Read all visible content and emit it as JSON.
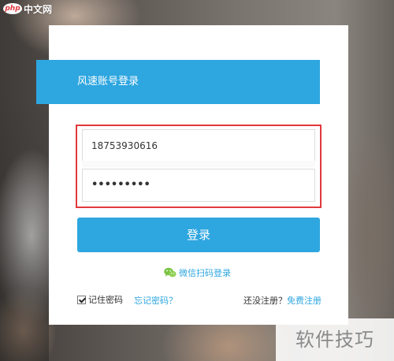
{
  "site_logo": {
    "php": "php",
    "text": "中文网"
  },
  "login": {
    "header_title": "风速账号登录",
    "phone_value": "18753930616",
    "password_mask": "•••••••••",
    "submit_label": "登录",
    "wechat_label": "微信扫码登录",
    "remember_label": "记住密码",
    "forgot_label": "忘记密码？",
    "no_account_label": "还没注册？",
    "register_link": "免费注册"
  },
  "watermark": "软件技巧",
  "colors": {
    "accent": "#2ea6e0",
    "highlight_border": "#e0393c",
    "wechat_green": "#7bc443"
  }
}
